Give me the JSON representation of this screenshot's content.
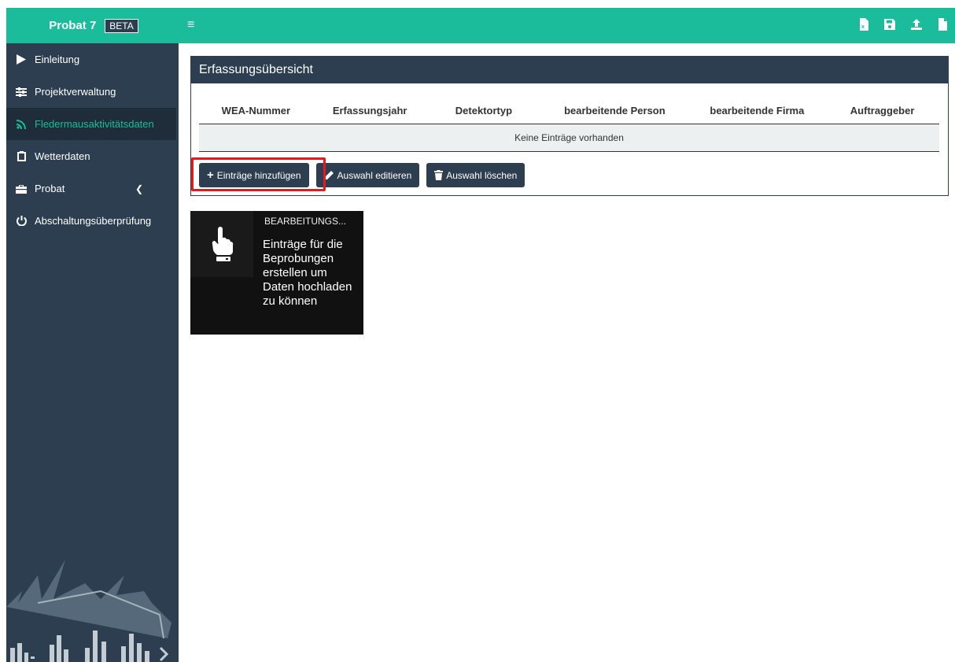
{
  "header": {
    "brand_name": "Probat 7",
    "brand_badge": "BETA",
    "menu_icon": "hamburger-icon",
    "actions": [
      {
        "name": "export-excel-icon"
      },
      {
        "name": "save-icon"
      },
      {
        "name": "upload-icon"
      },
      {
        "name": "file-icon"
      }
    ]
  },
  "sidebar": {
    "items": [
      {
        "label": "Einleitung",
        "icon": "play-icon"
      },
      {
        "label": "Projektverwaltung",
        "icon": "sliders-icon"
      },
      {
        "label": "Fledermausaktivitätsdaten",
        "icon": "rss-icon",
        "active": true
      },
      {
        "label": "Wetterdaten",
        "icon": "clipboard-icon"
      },
      {
        "label": "Probat",
        "icon": "toolbox-icon",
        "has_caret": true
      },
      {
        "label": "Abschaltungsüberprüfung",
        "icon": "power-icon"
      }
    ]
  },
  "panel": {
    "title": "Erfassungsübersicht",
    "columns": [
      "WEA-Nummer",
      "Erfassungsjahr",
      "Detektortyp",
      "bearbeitende Person",
      "bearbeitende Firma",
      "Auftraggeber"
    ],
    "empty_text": "Keine Einträge vorhanden",
    "buttons": {
      "add": "Einträge hinzufügen",
      "edit": "Auswahl editieren",
      "delete": "Auswahl löschen"
    }
  },
  "infobox": {
    "title": "BEARBEITUNGS...",
    "text": "Einträge für die Beprobungen erstellen um Daten hochladen zu können",
    "icon": "hand-pointer-icon"
  },
  "colors": {
    "accent": "#1abc9c",
    "sidebar": "#2c3e50",
    "highlight": "#e41a1c"
  }
}
